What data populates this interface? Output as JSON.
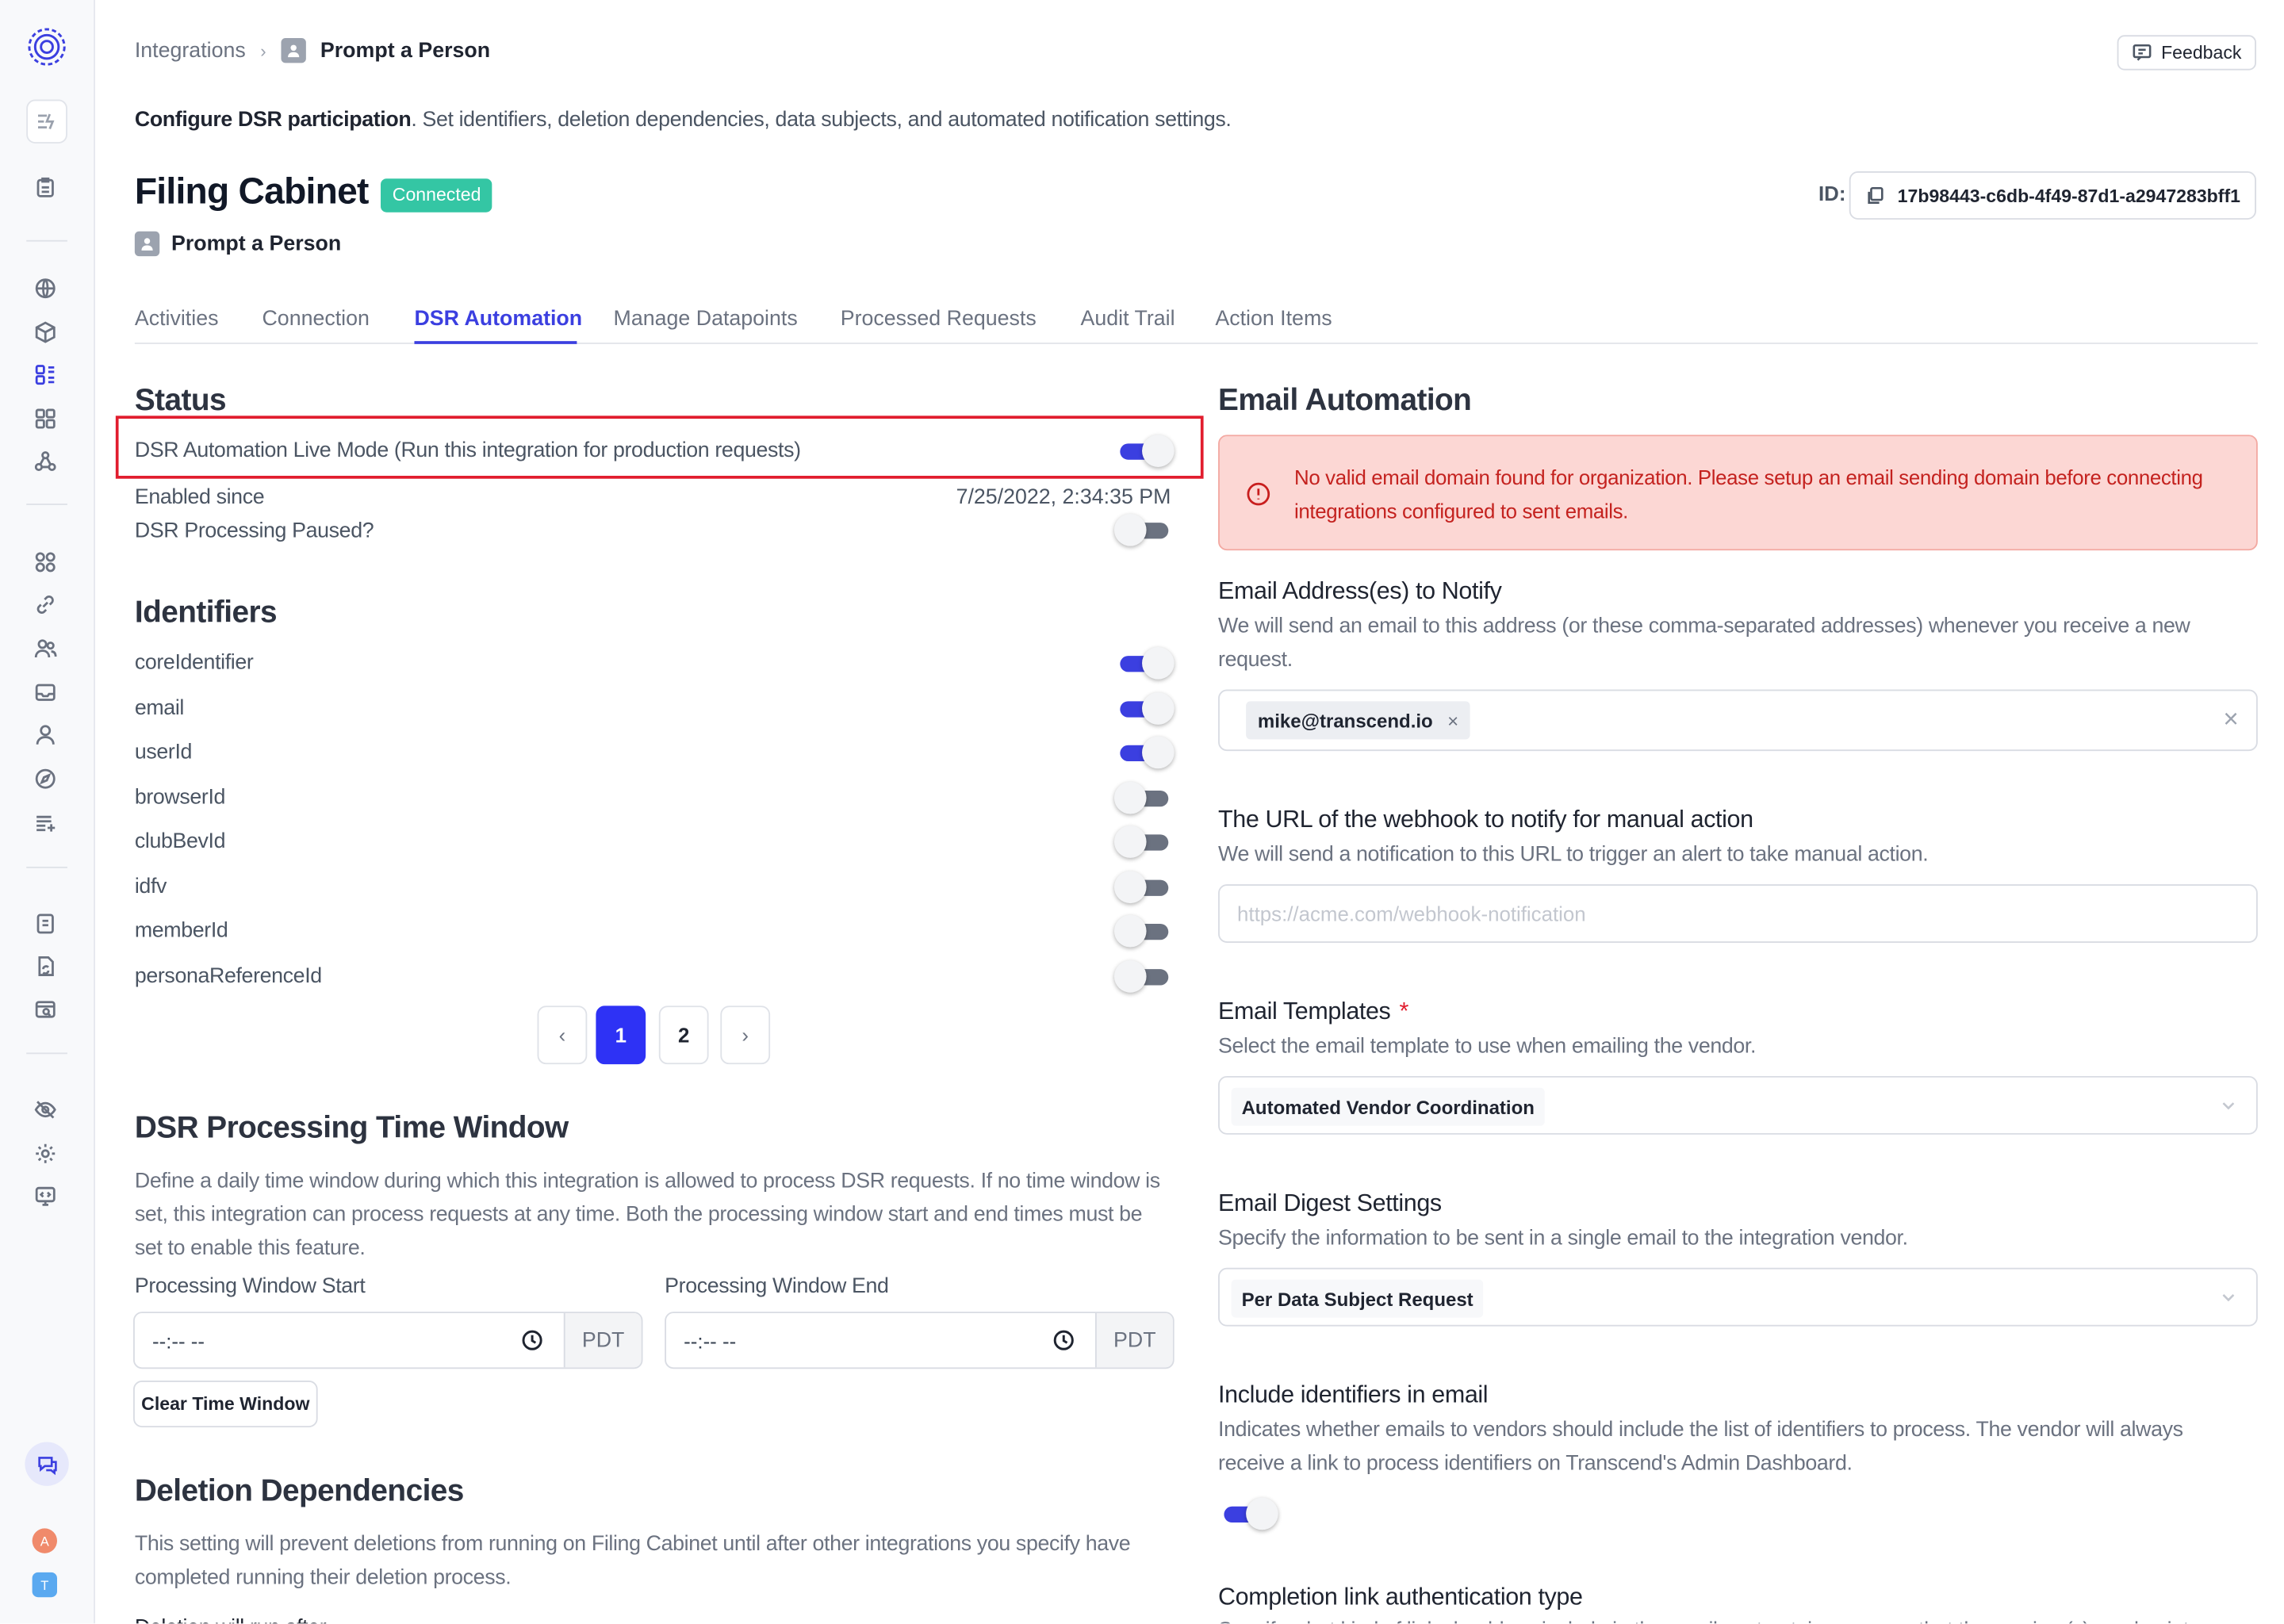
{
  "breadcrumb": {
    "parent": "Integrations",
    "current": "Prompt a Person"
  },
  "feedback_label": "Feedback",
  "subtitle": {
    "bold": "Configure DSR participation",
    "rest": ". Set identifiers, deletion dependencies, data subjects, and automated notification settings."
  },
  "integration": {
    "title": "Filing Cabinet",
    "status": "Connected",
    "owner": "Prompt a Person",
    "id_label": "ID:",
    "id_value": "17b98443-c6db-4f49-87d1-a2947283bff1"
  },
  "tabs": [
    "Activities",
    "Connection",
    "DSR Automation",
    "Manage Datapoints",
    "Processed Requests",
    "Audit Trail",
    "Action Items"
  ],
  "active_tab": "DSR Automation",
  "status": {
    "heading": "Status",
    "live_mode_label": "DSR Automation Live Mode (Run this integration for production requests)",
    "live_mode_on": true,
    "enabled_since_label": "Enabled since",
    "enabled_since_value": "7/25/2022, 2:34:35 PM",
    "paused_label": "DSR Processing Paused?",
    "paused_on": false
  },
  "identifiers": {
    "heading": "Identifiers",
    "items": [
      {
        "name": "coreIdentifier",
        "on": true
      },
      {
        "name": "email",
        "on": true
      },
      {
        "name": "userId",
        "on": true
      },
      {
        "name": "browserId",
        "on": false
      },
      {
        "name": "clubBevId",
        "on": false
      },
      {
        "name": "idfv",
        "on": false
      },
      {
        "name": "memberId",
        "on": false
      },
      {
        "name": "personaReferenceId",
        "on": false
      }
    ],
    "pagination": {
      "pages": [
        "1",
        "2"
      ],
      "current": "1",
      "prev": "‹",
      "next": "›"
    }
  },
  "time_window": {
    "heading": "DSR Processing Time Window",
    "description": "Define a daily time window during which this integration is allowed to process DSR requests. If no time window is set, this integration can process requests at any time. Both the processing window start and end times must be set to enable this feature.",
    "start_label": "Processing Window Start",
    "end_label": "Processing Window End",
    "start_value": "--:-- --",
    "end_value": "--:-- --",
    "timezone": "PDT",
    "clear_button": "Clear Time Window"
  },
  "deletion": {
    "heading": "Deletion Dependencies",
    "description": "This setting will prevent deletions from running on Filing Cabinet until after other integrations you specify have completed running their deletion process.",
    "run_after_label": "Deletion will run after"
  },
  "email_automation": {
    "heading": "Email Automation",
    "alert": "No valid email domain found for organization. Please setup an email sending domain before connecting integrations configured to sent emails.",
    "notify": {
      "label": "Email Address(es) to Notify",
      "help": "We will send an email to this address (or these comma-separated addresses) whenever you receive a new request.",
      "chips": [
        "mike@transcend.io"
      ],
      "chip_remove": "×",
      "clear": "×"
    },
    "webhook": {
      "label": "The URL of the webhook to notify for manual action",
      "help": "We will send a notification to this URL to trigger an alert to take manual action.",
      "placeholder": "https://acme.com/webhook-notification"
    },
    "templates": {
      "label": "Email Templates",
      "required_mark": "*",
      "help": "Select the email template to use when emailing the vendor.",
      "value": "Automated Vendor Coordination"
    },
    "digest": {
      "label": "Email Digest Settings",
      "help": "Specify the information to be sent in a single email to the integration vendor.",
      "value": "Per Data Subject Request"
    },
    "include_identifiers": {
      "label": "Include identifiers in email",
      "help": "Indicates whether emails to vendors should include the list of identifiers to process. The vendor will always receive a link to process identifiers on Transcend's Admin Dashboard.",
      "on": true
    },
    "completion_link": {
      "label": "Completion link authentication type",
      "help": "Specify what kind of link should we include in the email sent out, i.e. assume that the receiver(s) can log into"
    }
  },
  "sidebar": {
    "avatars": [
      {
        "initial": "A",
        "color": "#f08a6b"
      },
      {
        "initial": "T",
        "color": "#5aa9f0"
      }
    ]
  },
  "colors": {
    "accent": "#3b3fe0",
    "success": "#34c6a4",
    "danger": "#c4221f",
    "highlight": "#e11d2e"
  }
}
